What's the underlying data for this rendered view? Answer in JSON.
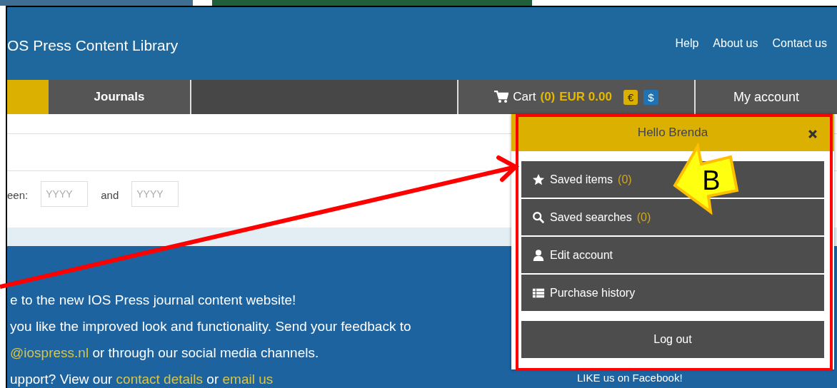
{
  "header": {
    "site_title": "OS Press Content Library",
    "links": [
      "Help",
      "About us",
      "Contact us"
    ]
  },
  "nav": {
    "tabs": [
      {
        "label": "Journals",
        "selected": false
      }
    ],
    "account_tab": "My account"
  },
  "cart": {
    "label": "Cart",
    "count": "(0)",
    "total": "EUR 0.00",
    "currencies": [
      {
        "symbol": "€",
        "selected": true
      },
      {
        "symbol": "$",
        "selected": false
      }
    ]
  },
  "search": {
    "between_label": "een:",
    "from_placeholder": "YYYY",
    "and_label": "and",
    "to_placeholder": "YYYY"
  },
  "welcome": {
    "lines": [
      [
        {
          "kind": "plain",
          "text": "e to the new IOS Press journal content website!"
        }
      ],
      [
        {
          "kind": "plain",
          "text": "you like the improved look and functionality. Send your feedback to"
        }
      ],
      [
        {
          "kind": "link",
          "text": "@iospress.nl"
        },
        {
          "kind": "plain",
          "text": " or through our social media channels."
        }
      ],
      [
        {
          "kind": "plain",
          "text": "upport? View our "
        },
        {
          "kind": "link",
          "text": "contact details"
        },
        {
          "kind": "plain",
          "text": " or "
        },
        {
          "kind": "link",
          "text": "email us"
        }
      ]
    ]
  },
  "facebook": "LIKE us on Facebook!",
  "account_menu": {
    "greeting": "Hello Brenda",
    "items": [
      {
        "kind": "star",
        "label": "Saved items",
        "count": "(0)"
      },
      {
        "kind": "search",
        "label": "Saved searches",
        "count": "(0)"
      },
      {
        "kind": "user",
        "label": "Edit account"
      },
      {
        "kind": "table",
        "label": "Purchase history"
      }
    ],
    "logout": "Log out"
  },
  "annotation": {
    "callout_letter": "B"
  }
}
